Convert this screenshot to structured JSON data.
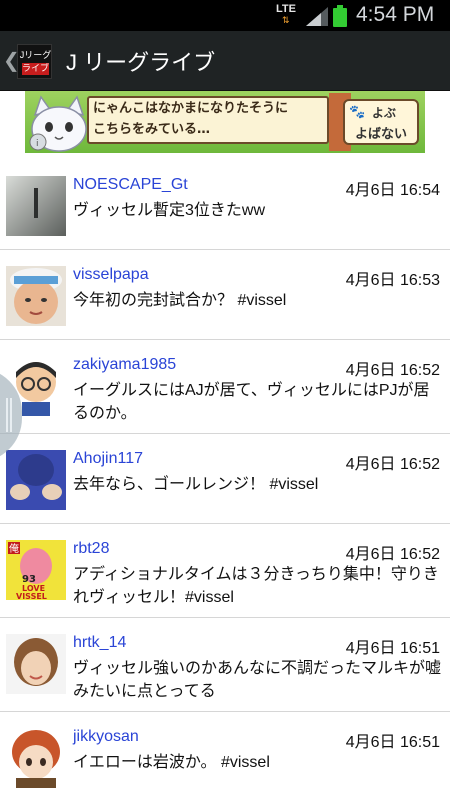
{
  "status": {
    "network": "LTE",
    "time": "4:54 PM",
    "battery_color": "#33cc33"
  },
  "action_bar": {
    "back_icon": "chevron-left",
    "icon_line1": "Jリーグ",
    "icon_line2": "ライブ",
    "title": "J リーグライブ"
  },
  "ad": {
    "line1": "にゃんこはなかまになりたそうに",
    "line2": "こちらをみている…",
    "button_line1": "よぶ",
    "button_line2": "よばない"
  },
  "tweets": [
    {
      "user": "NOESCAPE_Gt",
      "time": "4月6日 16:54",
      "text": "ヴィッセル暫定3位きたww"
    },
    {
      "user": "visselpapa",
      "time": "4月6日 16:53",
      "text": "今年初の完封試合か？ #vissel"
    },
    {
      "user": "zakiyama1985",
      "time": "4月6日 16:52",
      "text": "イーグルスにはAJが居て、ヴィッセルにはPJが居るのか。"
    },
    {
      "user": "Ahojin117",
      "time": "4月6日 16:52",
      "text": "去年なら、ゴールレンジ！ #vissel"
    },
    {
      "user": "rbt28",
      "time": "4月6日 16:52",
      "text": "アディショナルタイムは３分きっちり集中！守りきれヴィッセル！#vissel"
    },
    {
      "user": "hrtk_14",
      "time": "4月6日 16:51",
      "text": "ヴィッセル強いのかあんなに不調だったマルキが嘘みたいに点とってる"
    },
    {
      "user": "jikkyosan",
      "time": "4月6日 16:51",
      "text": "イエローは岩波か。 #vissel"
    }
  ],
  "avatar_badge_rbt28": {
    "top": "俺",
    "num": "93",
    "line1": "LOVE",
    "line2": "VISSEL"
  }
}
